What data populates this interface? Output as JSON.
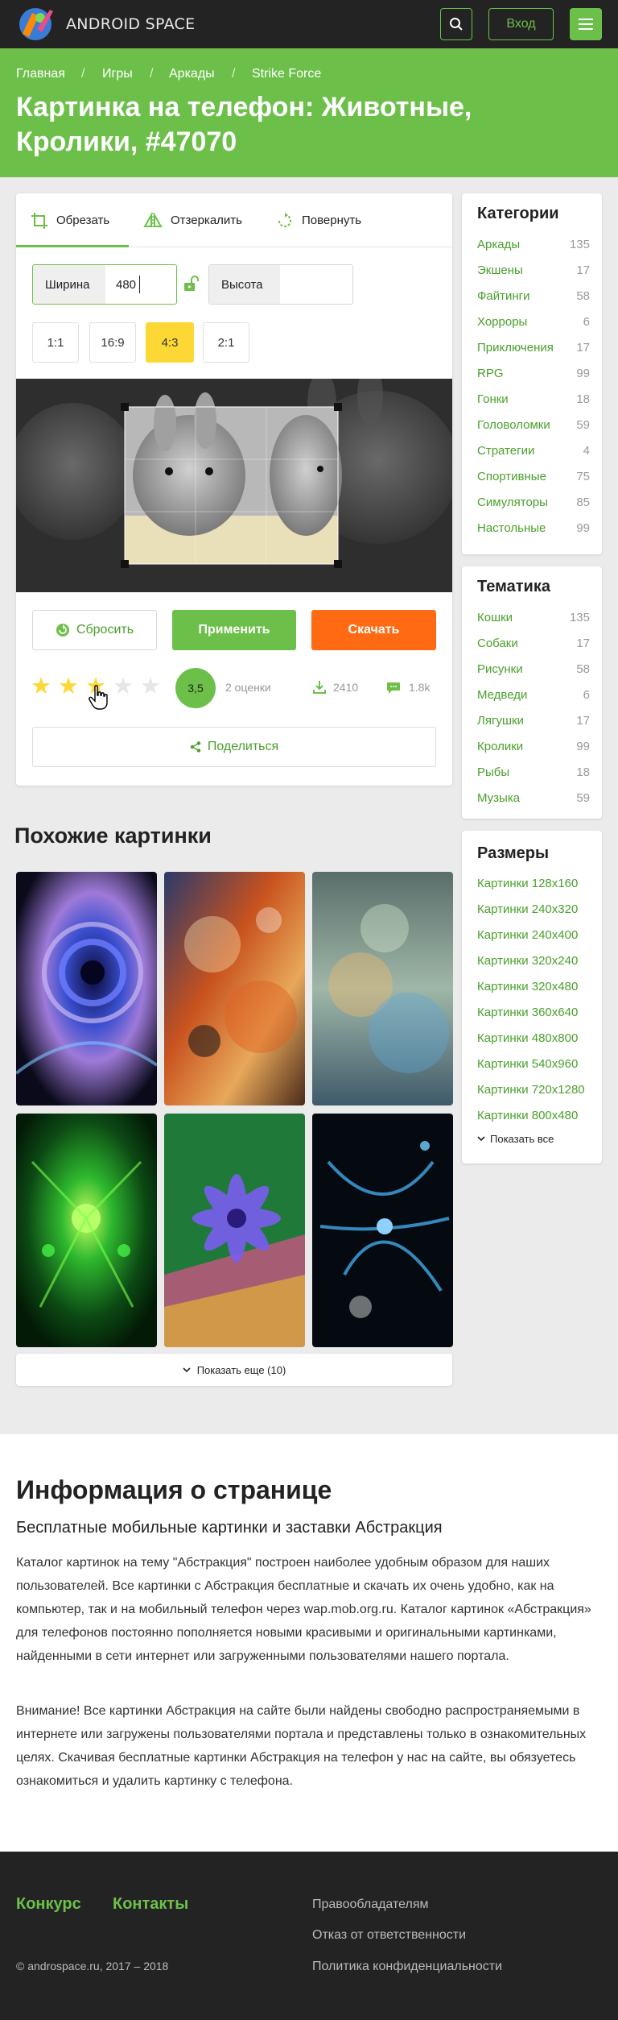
{
  "header": {
    "brand": "ANDROID SPACE",
    "login": "Вход"
  },
  "breadcrumbs": [
    "Главная",
    "Игры",
    "Аркады",
    "Strike Force"
  ],
  "page_title": "Картинка на телефон: Животные, Кролики, #47070",
  "editor": {
    "tabs": [
      "Обрезать",
      "Отзеркалить",
      "Повернуть"
    ],
    "width_label": "Ширина",
    "width_value": "480",
    "height_label": "Высота",
    "height_value": "",
    "ratios": [
      "1:1",
      "16:9",
      "4:3",
      "2:1"
    ],
    "active_ratio": "4:3",
    "reset": "Сбросить",
    "apply": "Применить",
    "download": "Скачать",
    "rating": {
      "stars_filled": 3,
      "stars_total": 5,
      "score": "3,5",
      "votes": "2 оценки"
    },
    "downloads": "2410",
    "comments": "1.8k",
    "share": "Поделиться"
  },
  "categories": {
    "title": "Категории",
    "items": [
      {
        "name": "Аркады",
        "count": "135"
      },
      {
        "name": "Экшены",
        "count": "17"
      },
      {
        "name": "Файтинги",
        "count": "58"
      },
      {
        "name": "Хорроры",
        "count": "6"
      },
      {
        "name": "Приключения",
        "count": "17"
      },
      {
        "name": "RPG",
        "count": "99"
      },
      {
        "name": "Гонки",
        "count": "18"
      },
      {
        "name": "Головоломки",
        "count": "59"
      },
      {
        "name": "Стратегии",
        "count": "4"
      },
      {
        "name": "Спортивные",
        "count": "75"
      },
      {
        "name": "Симуляторы",
        "count": "85"
      },
      {
        "name": "Настольные",
        "count": "99"
      }
    ]
  },
  "topics": {
    "title": "Тематика",
    "items": [
      {
        "name": "Кошки",
        "count": "135"
      },
      {
        "name": "Собаки",
        "count": "17"
      },
      {
        "name": "Рисунки",
        "count": "58"
      },
      {
        "name": "Медведи",
        "count": "6"
      },
      {
        "name": "Лягушки",
        "count": "17"
      },
      {
        "name": "Кролики",
        "count": "99"
      },
      {
        "name": "Рыбы",
        "count": "18"
      },
      {
        "name": "Музыка",
        "count": "59"
      }
    ]
  },
  "sizes": {
    "title": "Размеры",
    "items": [
      "Картинки 128x160",
      "Картинки 240x320",
      "Картинки 240x400",
      "Картинки 320x240",
      "Картинки 320x480",
      "Картинки 360x640",
      "Картинки 480x800",
      "Картинки 540x960",
      "Картинки 720x1280",
      "Картинки 800x480"
    ],
    "show_all": "Показать все"
  },
  "similar": {
    "title": "Похожие картинки",
    "more": "Показать еще (10)"
  },
  "info": {
    "title": "Информация о странице",
    "subtitle": "Бесплатные мобильные картинки и заставки Абстракция",
    "p1": "Каталог картинок на тему \"Абстракция\" построен наиболее удобным образом для наших пользователей. Все картинки с Абстракция бесплатные и скачать их очень удобно, как на компьютер, так и на мобильный телефон через wap.mob.org.ru. Каталог картинок «Абстракция» для телефонов постоянно пополняется новыми красивыми и оригинальными картинками, найденными в сети интернет или загруженными пользователями нашего портала.",
    "p2": "Внимание! Все картинки Абстракция на сайте были найдены свободно распространяемыми в интернете или загружены пользователями портала и представлены только в ознакомительных целях. Скачивая бесплатные картинки Абстракция на телефон у нас на сайте, вы обязуетесь ознакомиться и удалить картинку с телефона."
  },
  "footer": {
    "links_left": [
      "Конкурс",
      "Контакты"
    ],
    "links_right": [
      "Правообладателям",
      "Отказ от ответственности",
      "Политика конфиденциальности"
    ],
    "copyright": "© androspace.ru, 2017 – 2018"
  },
  "colors": {
    "brand_green": "#6cc04a",
    "accent_yellow": "#fdd835",
    "download_orange": "#ff6a13",
    "dark": "#232323"
  }
}
